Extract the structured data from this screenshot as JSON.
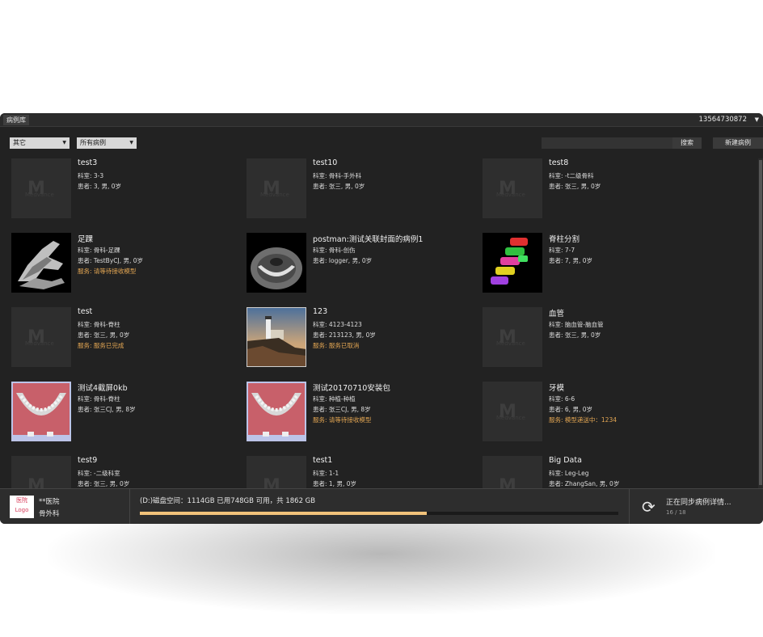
{
  "header": {
    "tab_label": "病例库",
    "account": "13564730872",
    "account_caret": "▼"
  },
  "toolbar": {
    "filter_category": "其它",
    "filter_cases": "所有病例",
    "search_placeholder": "",
    "search_label": "搜索",
    "new_case_label": "新建病例"
  },
  "placeholder_brand": "Medvance",
  "cases": [
    {
      "title": "test3",
      "dept": "科室: 3-3",
      "patient": "患者: 3, 男, 0岁",
      "status": "",
      "thumb": "placeholder-icon"
    },
    {
      "title": "test10",
      "dept": "科室: 骨科-手外科",
      "patient": "患者: 张三, 男, 0岁",
      "status": "",
      "thumb": "placeholder-icon"
    },
    {
      "title": "test8",
      "dept": "科室: -t二级骨科",
      "patient": "患者: 张三, 男, 0岁",
      "status": "",
      "thumb": "placeholder-icon"
    },
    {
      "title": "足踝",
      "dept": "科室: 骨科-足踝",
      "patient": "患者: TestByCJ, 男, 0岁",
      "status": "服务: 请等待接收模型",
      "thumb": "foot-xray"
    },
    {
      "title": "postman:测试关联封面的病例1",
      "dept": "科室: 骨科-创伤",
      "patient": "患者: logger, 男, 0岁",
      "status": "",
      "thumb": "ct-slice"
    },
    {
      "title": "脊柱分割",
      "dept": "科室: 7-7",
      "patient": "患者: 7, 男, 0岁",
      "status": "",
      "thumb": "spine-segmentation"
    },
    {
      "title": "test",
      "dept": "科室: 骨科-脊柱",
      "patient": "患者: 张三, 男, 0岁",
      "status": "服务: 服务已完成",
      "thumb": "placeholder-icon"
    },
    {
      "title": "123",
      "dept": "科室: 4123-4123",
      "patient": "患者: 213123, 男, 0岁",
      "status": "服务: 服务已取消",
      "thumb": "lighthouse-photo"
    },
    {
      "title": "血管",
      "dept": "科室: 脑血管-脑血管",
      "patient": "患者: 张三, 男, 0岁",
      "status": "",
      "thumb": "placeholder-icon"
    },
    {
      "title": "测试4截屏0kb",
      "dept": "科室: 骨科-脊柱",
      "patient": "患者: 张三CJ, 男, 8岁",
      "status": "",
      "thumb": "jaw-model"
    },
    {
      "title": "测试20170710安装包",
      "dept": "科室: 种植-种植",
      "patient": "患者: 张三CJ, 男, 8岁",
      "status": "服务: 请等待接收模型",
      "thumb": "jaw-model"
    },
    {
      "title": "牙模",
      "dept": "科室: 6-6",
      "patient": "患者: 6, 男, 0岁",
      "status": "服务: 模型递送中：1234",
      "thumb": "placeholder-icon"
    },
    {
      "title": "test9",
      "dept": "科室: -二级科室",
      "patient": "患者: 张三, 男, 0岁",
      "status": "",
      "thumb": "placeholder-icon"
    },
    {
      "title": "test1",
      "dept": "科室: 1-1",
      "patient": "患者: 1, 男, 0岁",
      "status": "",
      "thumb": "placeholder-icon"
    },
    {
      "title": "Big Data",
      "dept": "科室: Leg-Leg",
      "patient": "患者: ZhangSan, 男, 0岁",
      "status": "",
      "thumb": "placeholder-icon"
    }
  ],
  "footer": {
    "logo_line1": "医院",
    "logo_line2": "Logo",
    "hospital": "**医院",
    "department": "骨外科",
    "disk_text": "(D:)磁盘空间：1114GB 已用748GB 可用，共 1862 GB",
    "disk_used_fraction": 0.6,
    "sync_icon": "sync-icon",
    "sync_text": "正在同步病例详情...",
    "sync_count": "16 / 18"
  }
}
